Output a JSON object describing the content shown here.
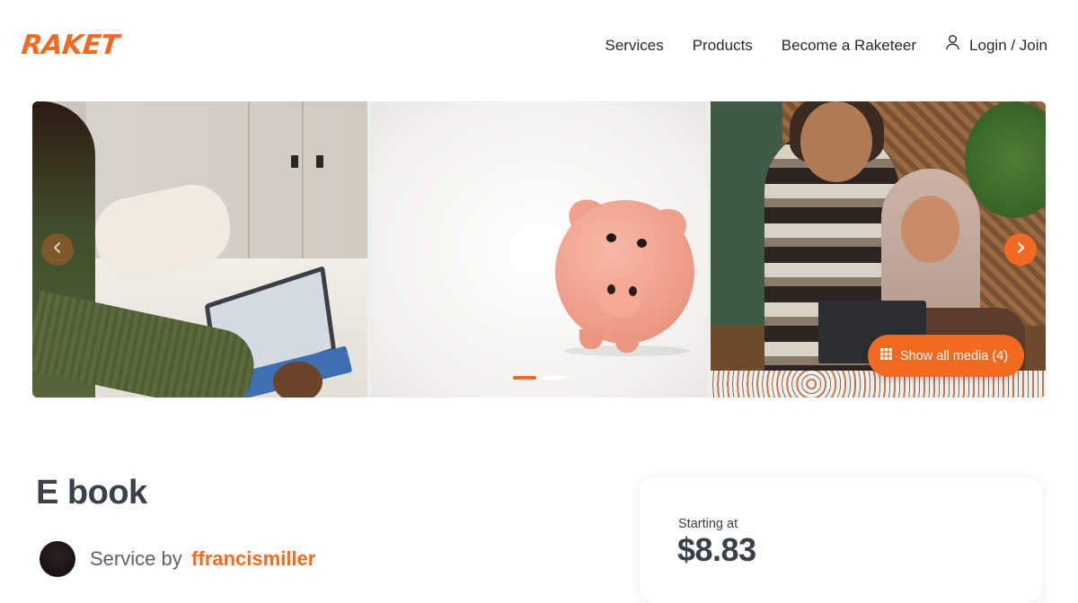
{
  "brand": {
    "name": "RAKET",
    "accent_color": "#f26a21"
  },
  "nav": {
    "items": [
      {
        "label": "Services"
      },
      {
        "label": "Products"
      },
      {
        "label": "Become a Raketeer"
      }
    ],
    "login_label": "Login / Join",
    "login_icon": "user-icon"
  },
  "gallery": {
    "images": [
      "woman-using-tablet-on-bed",
      "piggy-bank",
      "two-women-at-laptop"
    ],
    "show_media_label": "Show all media (4)",
    "show_media_icon": "grid-icon",
    "prev_icon": "chevron-left-icon",
    "next_icon": "chevron-right-icon",
    "slide_count": 2,
    "active_slide": 1
  },
  "listing": {
    "title": "E book",
    "service_by_label": "Service by",
    "seller": "ffrancismiller"
  },
  "pricing": {
    "starting_label": "Starting at",
    "price": "$8.83"
  }
}
